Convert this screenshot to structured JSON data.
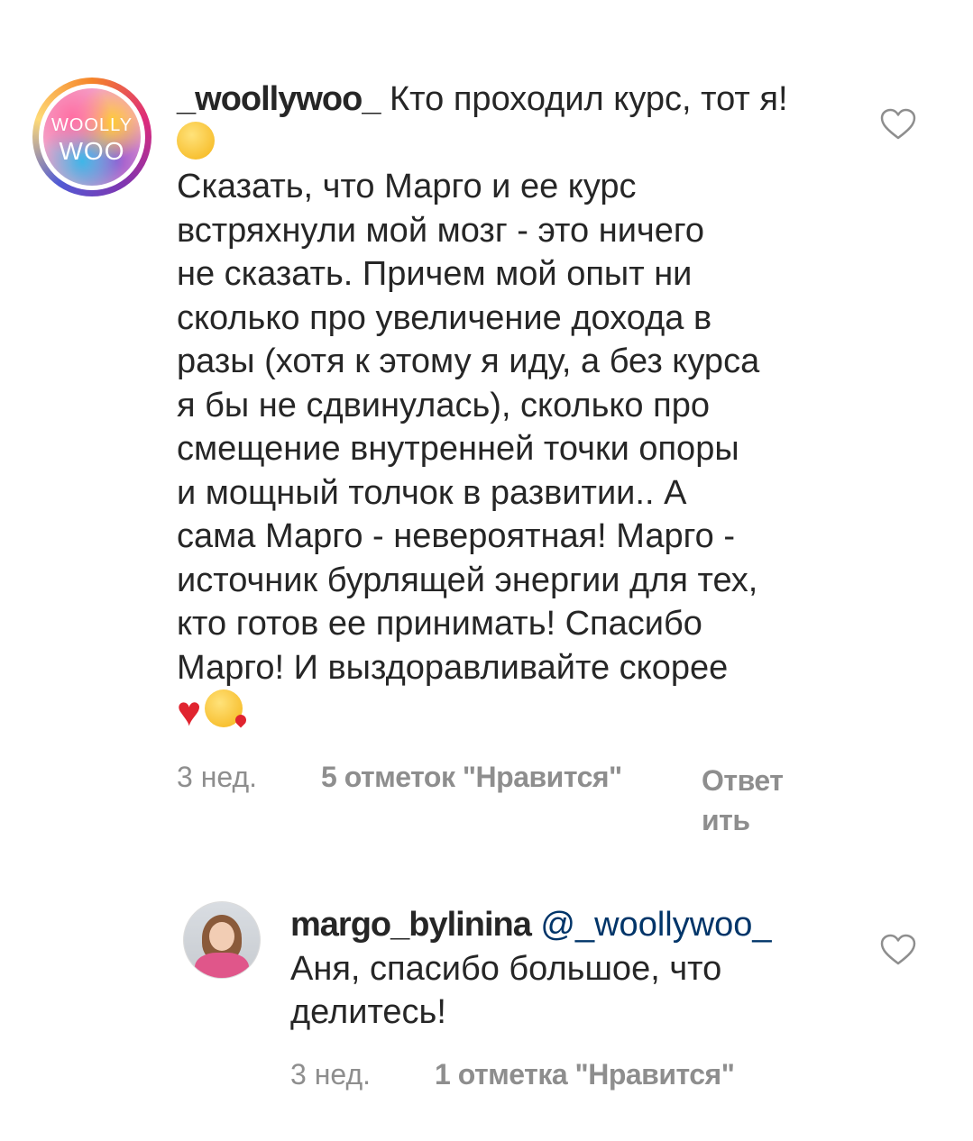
{
  "comments": [
    {
      "username": "_woollywoo_",
      "avatar_text_line1": "WOOLLY",
      "avatar_text_line2": "WOO",
      "text_intro": "Кто проходил курс, тот я!",
      "text_body": "Сказать, что Марго и ее курс\nвстряхнули мой мозг - это ничего\nне сказать. Причем мой опыт ни\nсколько про увеличение дохода в\nразы (хотя к этому я иду, а без курса\nя бы не сдвинулась), сколько про\nсмещение внутренней точки опоры\nи мощный толчок в развитии.. А\nсама Марго - невероятная! Марго -\nисточник бурлящей энергии для тех,\nкто готов ее принимать! Спасибо\nМарго! И выздоравливайте скорее",
      "emoji_after_intro": "hugging-face-emoji",
      "emoji_end": [
        "red-heart-emoji",
        "face-blowing-kiss-emoji"
      ],
      "time": "3 нед.",
      "likes": "5 отметок \"Нравится\"",
      "reply": "Ответ\nить",
      "like_icon": "heart-outline-icon"
    },
    {
      "username": "margo_bylinina",
      "mention": "@_woollywoo_",
      "text_body": "Аня, спасибо большое, что\nделитесь!",
      "time": "3 нед.",
      "likes": "1 отметка \"Нравится\"",
      "like_icon": "heart-outline-icon"
    }
  ],
  "colors": {
    "text": "#262626",
    "meta": "#8e8e8e",
    "mention": "#003569",
    "heart": "#e0242f"
  }
}
